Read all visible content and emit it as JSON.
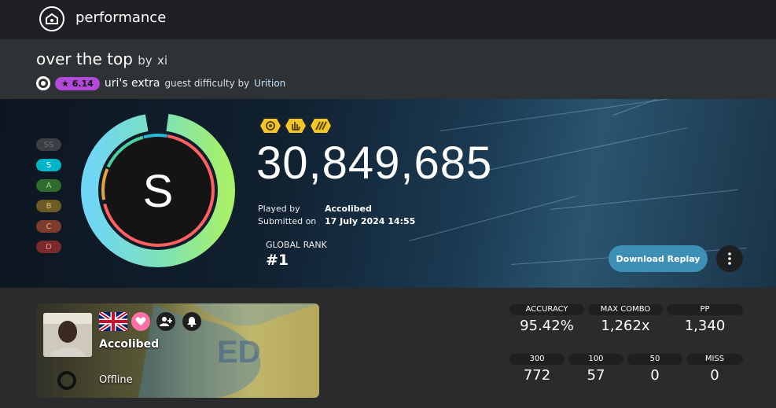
{
  "topbar": {
    "title": "performance",
    "logo_icon": "osu-logo-icon"
  },
  "beatmap": {
    "title": "over the top",
    "by_word": "by",
    "artist": "xi",
    "star_rating": "★ 6.14",
    "difficulty": "uri's extra",
    "guest_text": "guest difficulty by",
    "guest_mapper": "Urition"
  },
  "grades": [
    "SS",
    "S",
    "A",
    "B",
    "C",
    "D"
  ],
  "score": {
    "grade": "S",
    "total": "30,849,685",
    "played_by_label": "Played by",
    "played_by": "Accolibed",
    "submitted_label": "Submitted on",
    "submitted": "17 July 2024 14:55",
    "rank_label": "GLOBAL RANK",
    "rank": "#1",
    "accuracy_fraction": 0.9542
  },
  "mods": [
    "hidden-mod-icon",
    "hard-rock-mod-icon",
    "double-time-mod-icon"
  ],
  "actions": {
    "download": "Download Replay",
    "more_icon": "more-vertical-icon"
  },
  "user": {
    "name": "Accolibed",
    "status": "Offline",
    "country_flag": "uk-flag-icon"
  },
  "stats_top": [
    {
      "label": "ACCURACY",
      "value": "95.42%"
    },
    {
      "label": "MAX COMBO",
      "value": "1,262x"
    },
    {
      "label": "PP",
      "value": "1,340"
    }
  ],
  "stats_bottom": [
    {
      "label": "300",
      "value": "772"
    },
    {
      "label": "100",
      "value": "57"
    },
    {
      "label": "50",
      "value": "0"
    },
    {
      "label": "MISS",
      "value": "0"
    }
  ],
  "colors": {
    "grade_ss": "#3a3f44",
    "grade_s": "#00b5c7",
    "grade_a": "#3f8f3a",
    "grade_b": "#8a7232",
    "grade_c": "#a3553e",
    "grade_d": "#a23a3a",
    "ring_outer": "#7bd8f0",
    "ring_inner": "#ff6a63",
    "accent": "#3d8fb5",
    "mod_yellow": "#f4c527"
  }
}
